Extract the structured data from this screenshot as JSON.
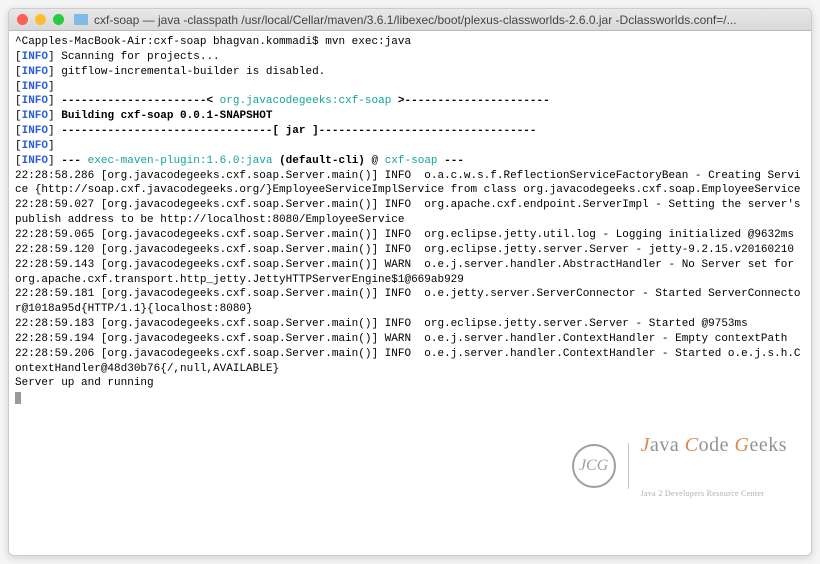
{
  "window": {
    "title": "cxf-soap — java -classpath /usr/local/Cellar/maven/3.6.1/libexec/boot/plexus-classworlds-2.6.0.jar -Dclassworlds.conf=/..."
  },
  "prompt": {
    "host": "^Capples-MacBook-Air:cxf-soap bhagvan.kommadi$ ",
    "cmd": "mvn exec:java"
  },
  "lines": {
    "l1": "Scanning for projects...",
    "l2": "gitflow-incremental-builder is disabled.",
    "l4a": "----------------------< ",
    "l4b": "org.javacodegeeks:cxf-soap",
    "l4c": " >----------------------",
    "l5": "Building cxf-soap 0.0.1-SNAPSHOT",
    "l6": "--------------------------------[ jar ]---------------------------------",
    "l8a": "--- ",
    "l8b": "exec-maven-plugin:1.6.0:java",
    "l8c": " (default-cli)",
    "l8d": " @ ",
    "l8e": "cxf-soap",
    "l8f": " ---",
    "b1": "22:28:58.286 [org.javacodegeeks.cxf.soap.Server.main()] INFO  o.a.c.w.s.f.ReflectionServiceFactoryBean - Creating Service {http://soap.cxf.javacodegeeks.org/}EmployeeServiceImplService from class org.javacodegeeks.cxf.soap.EmployeeService",
    "b2": "22:28:59.027 [org.javacodegeeks.cxf.soap.Server.main()] INFO  org.apache.cxf.endpoint.ServerImpl - Setting the server's publish address to be http://localhost:8080/EmployeeService",
    "b3": "22:28:59.065 [org.javacodegeeks.cxf.soap.Server.main()] INFO  org.eclipse.jetty.util.log - Logging initialized @9632ms",
    "b4": "22:28:59.120 [org.javacodegeeks.cxf.soap.Server.main()] INFO  org.eclipse.jetty.server.Server - jetty-9.2.15.v20160210",
    "b5": "22:28:59.143 [org.javacodegeeks.cxf.soap.Server.main()] WARN  o.e.j.server.handler.AbstractHandler - No Server set for org.apache.cxf.transport.http_jetty.JettyHTTPServerEngine$1@669ab929",
    "b6": "22:28:59.181 [org.javacodegeeks.cxf.soap.Server.main()] INFO  o.e.jetty.server.ServerConnector - Started ServerConnector@1018a95d{HTTP/1.1}{localhost:8080}",
    "b7": "22:28:59.183 [org.javacodegeeks.cxf.soap.Server.main()] INFO  org.eclipse.jetty.server.Server - Started @9753ms",
    "b8": "22:28:59.194 [org.javacodegeeks.cxf.soap.Server.main()] WARN  o.e.j.server.handler.ContextHandler - Empty contextPath",
    "b9": "22:28:59.206 [org.javacodegeeks.cxf.soap.Server.main()] INFO  o.e.j.server.handler.ContextHandler - Started o.e.j.s.h.ContextHandler@48d30b76{/,null,AVAILABLE}",
    "b10": "Server up and running"
  },
  "info_label": "INFO",
  "watermark": {
    "badge": "JCG",
    "w1": "J",
    "w2": "ava ",
    "w3": "C",
    "w4": "ode ",
    "w5": "G",
    "w6": "eeks",
    "sub": "Java 2 Developers Resource Center"
  }
}
